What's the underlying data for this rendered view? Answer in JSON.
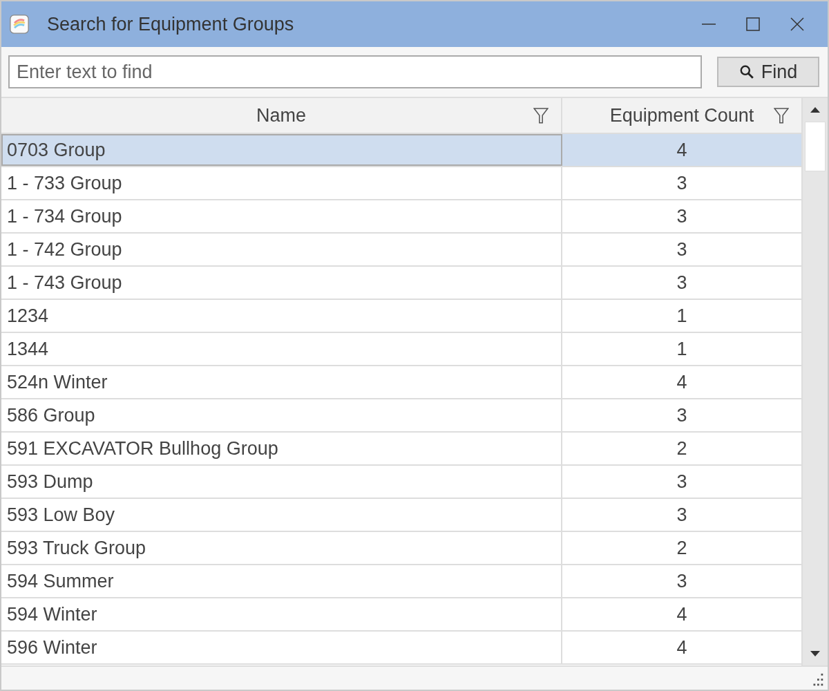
{
  "window": {
    "title": "Search for Equipment Groups"
  },
  "search": {
    "placeholder": "Enter text to find",
    "button": "Find"
  },
  "table": {
    "columns": [
      "Name",
      "Equipment Count"
    ],
    "rows": [
      {
        "name": "0703 Group",
        "count": "4",
        "selected": true
      },
      {
        "name": "1 - 733 Group",
        "count": "3",
        "selected": false
      },
      {
        "name": "1 - 734 Group",
        "count": "3",
        "selected": false
      },
      {
        "name": "1 - 742 Group",
        "count": "3",
        "selected": false
      },
      {
        "name": "1 - 743 Group",
        "count": "3",
        "selected": false
      },
      {
        "name": "1234",
        "count": "1",
        "selected": false
      },
      {
        "name": "1344",
        "count": "1",
        "selected": false
      },
      {
        "name": "524n Winter",
        "count": "4",
        "selected": false
      },
      {
        "name": "586 Group",
        "count": "3",
        "selected": false
      },
      {
        "name": "591 EXCAVATOR Bullhog Group",
        "count": "2",
        "selected": false
      },
      {
        "name": "593 Dump",
        "count": "3",
        "selected": false
      },
      {
        "name": "593 Low Boy",
        "count": "3",
        "selected": false
      },
      {
        "name": "593 Truck Group",
        "count": "2",
        "selected": false
      },
      {
        "name": "594 Summer",
        "count": "3",
        "selected": false
      },
      {
        "name": "594 Winter",
        "count": "4",
        "selected": false
      },
      {
        "name": "596 Winter",
        "count": "4",
        "selected": false
      }
    ]
  }
}
